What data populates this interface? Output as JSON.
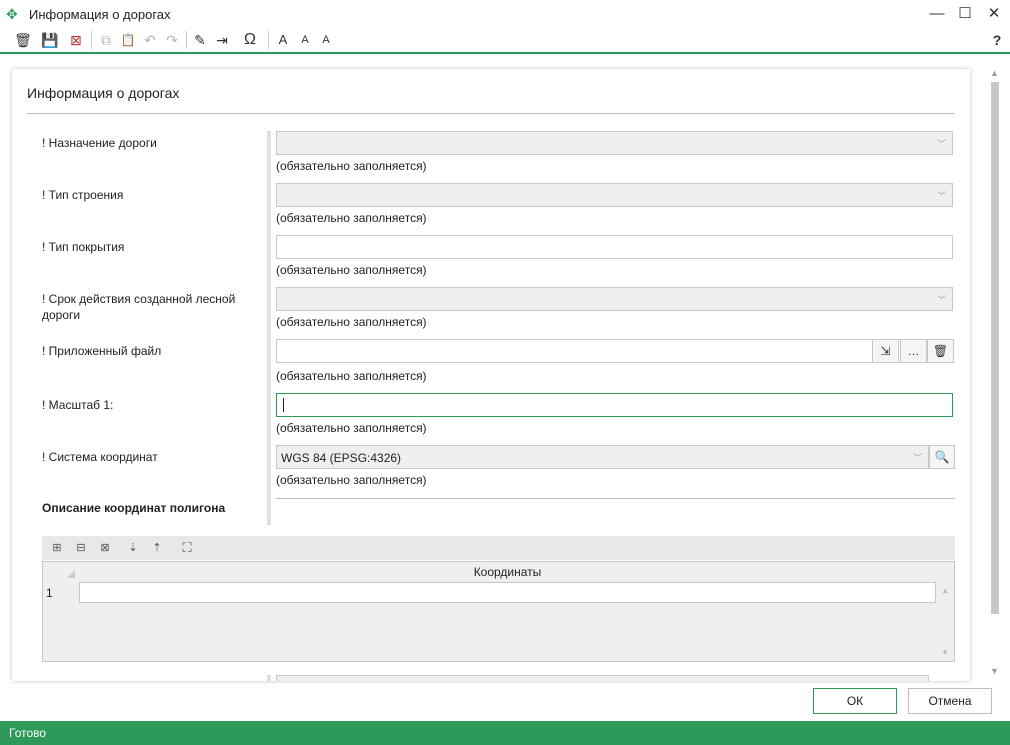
{
  "window": {
    "title": "Информация о дорогах",
    "minimize_glyph": "—",
    "maximize_glyph": "☐",
    "close_glyph": "✕"
  },
  "toolbar": {
    "buttons": [
      {
        "icon": "delete-icon",
        "glyph": "🗑"
      },
      {
        "icon": "save-icon",
        "glyph": "💾"
      },
      {
        "icon": "close-doc-icon",
        "glyph": "⊠"
      },
      {
        "icon": "copy-icon",
        "glyph": "⧉"
      },
      {
        "icon": "paste-icon",
        "glyph": "📋"
      },
      {
        "icon": "undo-icon",
        "glyph": "↶"
      },
      {
        "icon": "redo-icon",
        "glyph": "↷"
      },
      {
        "icon": "magic-wand-icon",
        "glyph": "✎"
      },
      {
        "icon": "import-icon",
        "glyph": "⇥"
      },
      {
        "icon": "omega-icon",
        "glyph": "Ω"
      },
      {
        "icon": "font-increase-icon",
        "glyph": "A"
      },
      {
        "icon": "font-decrease-icon",
        "glyph": "A"
      },
      {
        "icon": "font-reset-icon",
        "glyph": "A"
      },
      {
        "icon": "help-icon",
        "glyph": "?"
      }
    ]
  },
  "form": {
    "title": "Информация о дорогах",
    "required_hint": "(обязательно заполняется)",
    "fields": [
      {
        "label": "! Назначение дороги",
        "value": "",
        "type": "dropdown"
      },
      {
        "label": "! Тип строения",
        "value": "",
        "type": "dropdown"
      },
      {
        "label": "! Тип покрытия",
        "value": "",
        "type": "text"
      },
      {
        "label": "! Срок действия созданной лесной дороги",
        "value": "",
        "type": "dropdown"
      },
      {
        "label": "! Приложенный файл",
        "value": "",
        "type": "file"
      },
      {
        "label": "! Масштаб 1:",
        "value": "",
        "type": "text"
      },
      {
        "label": "! Система координат",
        "value": "WGS 84 (EPSG:4326)",
        "type": "dropdown"
      }
    ],
    "file_buttons": {
      "browse_glyph": "…",
      "attach_glyph": "⇲",
      "delete_glyph": "🗑"
    },
    "search_glyph": "🔍",
    "section_title": "Описание координат полигона",
    "grid": {
      "column_header": "Координаты",
      "rows": [
        {
          "num": "1",
          "value": ""
        }
      ]
    }
  },
  "buttons": {
    "ok": "ОК",
    "cancel": "Отмена"
  },
  "status": {
    "text": "Готово"
  },
  "colors": {
    "accent": "#2e9a5a"
  }
}
